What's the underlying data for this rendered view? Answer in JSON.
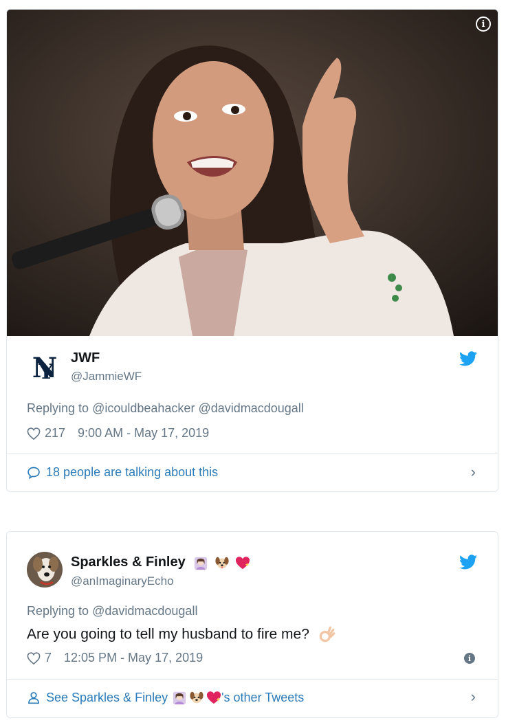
{
  "tweet1": {
    "photo_info_label": "i",
    "display_name": "JWF",
    "handle": "@JammieWF",
    "reply_prefix": "Replying to",
    "reply_targets": "@icouldbeahacker @davidmacdougall",
    "likes": "217",
    "timestamp": "9:00 AM - May 17, 2019",
    "conversation_label": "18 people are talking about this",
    "chevron": "›"
  },
  "tweet2": {
    "display_name": "Sparkles & Finley",
    "handle": "@anImaginaryEcho",
    "reply_prefix": "Replying to",
    "reply_targets": "@davidmacdougall",
    "text": "Are you going to tell my husband to fire me?",
    "likes": "7",
    "timestamp": "12:05 PM - May 17, 2019",
    "info_label": "i",
    "see_prefix": "See Sparkles & Finley",
    "see_suffix": "'s other Tweets",
    "chevron": "›"
  },
  "colors": {
    "link_blue": "#2b7bb9",
    "twitter_blue": "#1da1f2",
    "muted_gray": "#657786",
    "border": "#e1e8ed"
  },
  "icons": [
    "info-icon",
    "yankees-logo",
    "twitter-bird-icon",
    "heart-icon",
    "speech-bubble-icon",
    "chevron-right-icon",
    "person-icon",
    "ok-hand-emoji",
    "woman-raising-hand-emoji",
    "dog-face-emoji",
    "sparkling-heart-emoji"
  ]
}
